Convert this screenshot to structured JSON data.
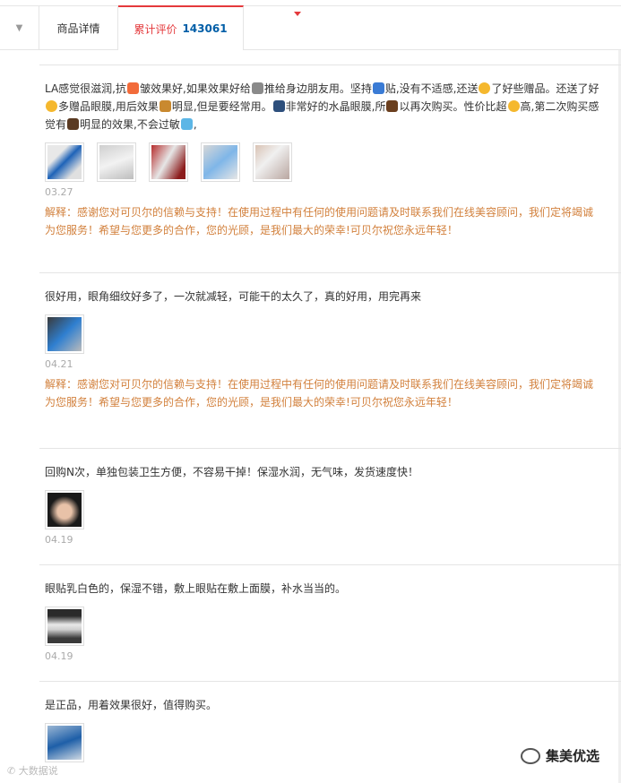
{
  "tabs": {
    "detail_label": "商品详情",
    "reviews_label": "累计评价",
    "reviews_count": "143061"
  },
  "reviews": [
    {
      "text_parts": [
        "LA感觉很滋润,抗",
        "皱效果好,如果效果好给",
        "推给身边朋友用。坚持",
        "贴,没有不适感,还送",
        "了好些赠品。还送了好",
        "多赠品眼膜,用后效果",
        "明显,但是要经常用。",
        "非常好的水晶眼膜,所",
        "以再次购买。性价比超",
        "高,第二次购买感觉有",
        "明显的效果,不会过敏"
      ],
      "date": "03.27",
      "reply": "解释：感谢您对可贝尔的信赖与支持！在使用过程中有任何的使用问题请及时联系我们在线美容顾问，我们定将竭诚为您服务！希望与您更多的合作，您的光顾，是我们最大的荣幸!可贝尔祝您永远年轻！"
    },
    {
      "text": "很好用，眼角细纹好多了，一次就减轻，可能干的太久了，真的好用，用完再来",
      "date": "04.21",
      "reply": "解释：感谢您对可贝尔的信赖与支持！在使用过程中有任何的使用问题请及时联系我们在线美容顾问，我们定将竭诚为您服务！希望与您更多的合作，您的光顾，是我们最大的荣幸!可贝尔祝您永远年轻！"
    },
    {
      "text": "回购N次，单独包装卫生方便，不容易干掉！保湿水润，无气味，发货速度快！",
      "date": "04.19"
    },
    {
      "text": "眼贴乳白色的，保湿不错，敷上眼贴在敷上面膜，补水当当的。",
      "date": "04.19"
    },
    {
      "text": "是正品，用着效果很好，值得购买。"
    }
  ],
  "watermarks": {
    "left": "大数据说",
    "right": "集美优选"
  },
  "colors": {
    "accent_red": "#e4393c",
    "count_blue": "#005ea7",
    "reply_orange": "#d2803c"
  }
}
